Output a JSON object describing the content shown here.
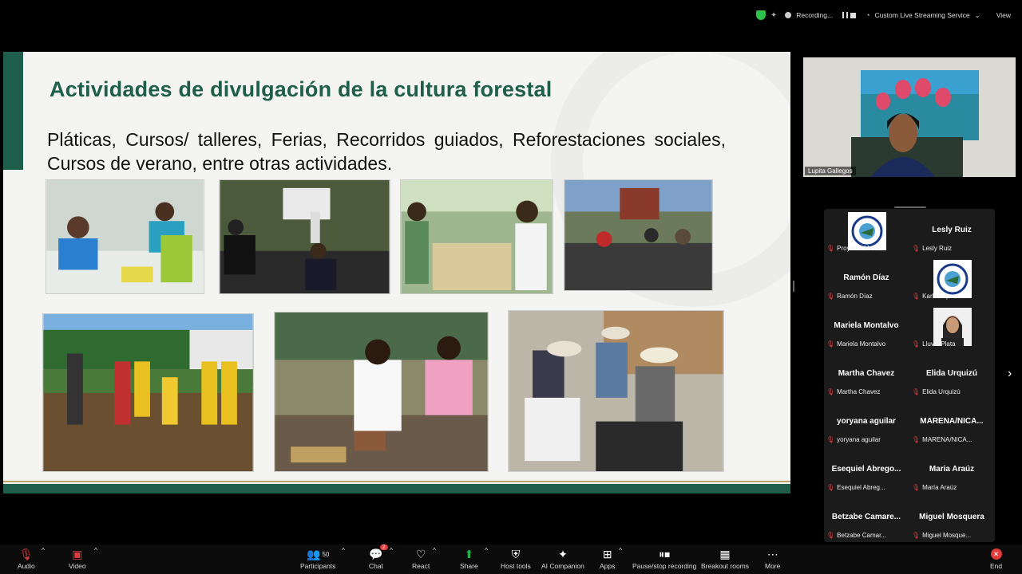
{
  "topbar": {
    "recording_label": "Recording...",
    "stream_label": "Custom Live Streaming Service",
    "view_label": "View"
  },
  "slide": {
    "title": "Actividades de divulgación de la cultura forestal",
    "body": "Pláticas, Cursos/ talleres, Ferias, Recorridos guiados, Reforestaciones sociales, Cursos de verano, entre otras actividades."
  },
  "self_video": {
    "name": "Lupita Gallegos"
  },
  "participants": [
    {
      "name": "",
      "label": "Proyecto Mesel...",
      "has_avatar": true,
      "avatar": "logo"
    },
    {
      "name": "Lesly Ruiz",
      "label": "Lesly Ruiz"
    },
    {
      "name": "Ramón Díaz",
      "label": "Ramón Díaz"
    },
    {
      "name": "",
      "label": "Karla López",
      "has_avatar": true,
      "avatar": "logo"
    },
    {
      "name": "Mariela Montalvo",
      "label": "Mariela Montalvo"
    },
    {
      "name": "",
      "label": "Lluvia Plata",
      "has_avatar": true,
      "avatar": "photo"
    },
    {
      "name": "Martha Chavez",
      "label": "Martha Chavez"
    },
    {
      "name": "Elida Urquizú",
      "label": "Elida Urquizú"
    },
    {
      "name": "yoryana aguilar",
      "label": "yoryana aguilar"
    },
    {
      "name": "MARENA/NICA...",
      "label": "MARENA/NICA..."
    },
    {
      "name": "Esequiel Abrego...",
      "label": "Esequiel Abreg..."
    },
    {
      "name": "Maria Araúz",
      "label": "María Araúz"
    },
    {
      "name": "Betzabe Camare...",
      "label": "Betzabe Camar..."
    },
    {
      "name": "Miguel Mosquera",
      "label": "Miguel Mosque..."
    }
  ],
  "toolbar": {
    "audio": "Audio",
    "video": "Video",
    "participants": "Participants",
    "participants_count": "50",
    "chat": "Chat",
    "chat_badge": "2",
    "react": "React",
    "share": "Share",
    "host_tools": "Host tools",
    "ai_companion": "AI Companion",
    "apps": "Apps",
    "pause_stop": "Pause/stop recording",
    "breakout": "Breakout rooms",
    "more": "More",
    "end": "End"
  },
  "colors": {
    "slide_green": "#1e5e4a",
    "accent_gold": "#b9a46a",
    "end_red": "#e03a3a",
    "share_green": "#22b14c"
  }
}
